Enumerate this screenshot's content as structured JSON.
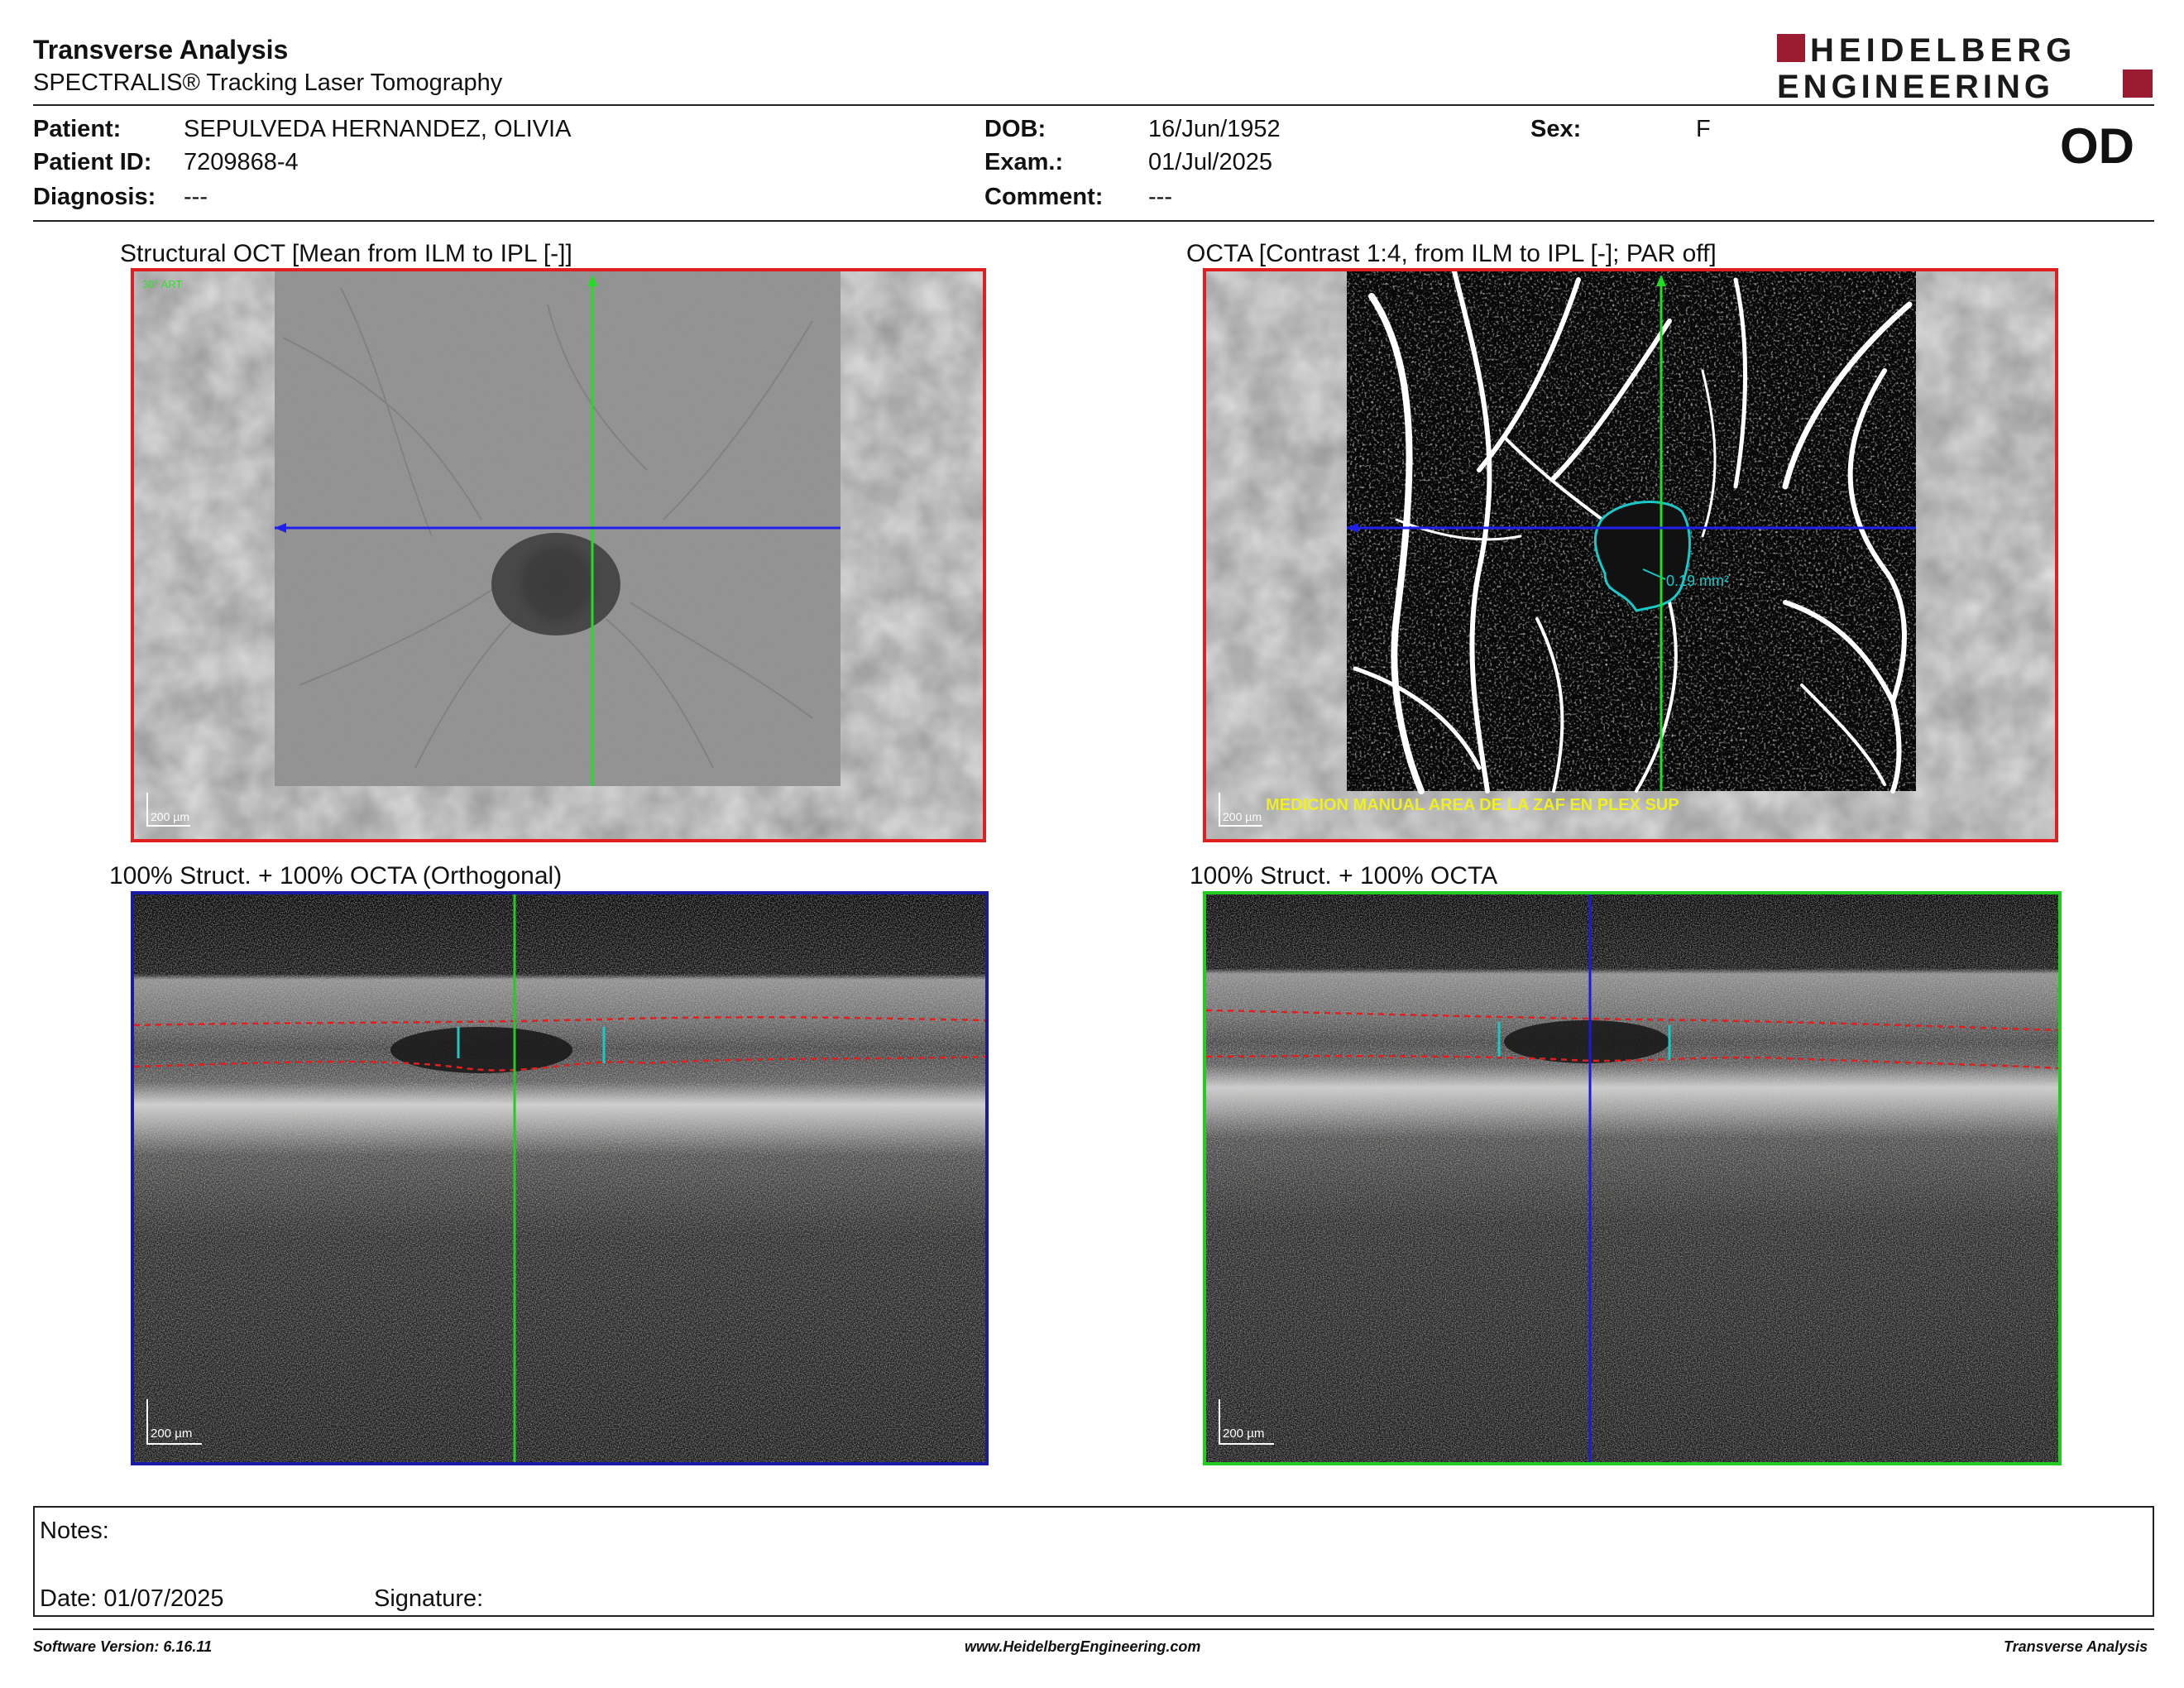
{
  "header": {
    "title": "Transverse Analysis",
    "subtitle": "SPECTRALIS® Tracking Laser Tomography",
    "brand_line1": "HEIDELBERG",
    "brand_line2": "ENGINEERING",
    "brand_color": "#9b1b30",
    "eye": "OD"
  },
  "patient": {
    "patient_label": "Patient:",
    "patient_value": "SEPULVEDA HERNANDEZ, OLIVIA",
    "id_label": "Patient ID:",
    "id_value": "7209868-4",
    "diagnosis_label": "Diagnosis:",
    "diagnosis_value": "---",
    "dob_label": "DOB:",
    "dob_value": "16/Jun/1952",
    "exam_label": "Exam.:",
    "exam_value": "01/Jul/2025",
    "comment_label": "Comment:",
    "comment_value": "---",
    "sex_label": "Sex:",
    "sex_value": "F"
  },
  "panels": {
    "structural": {
      "title": "Structural OCT [Mean from ILM to IPL [-]]",
      "scale": "200 µm",
      "corner": "30° ART",
      "border_color": "#e02020"
    },
    "octa": {
      "title": "OCTA [Contrast 1:4, from ILM to IPL [-]; PAR off]",
      "scale": "200 µm",
      "area": "0.19 mm²",
      "annotation": "MEDICION MANUAL AREA DE LA ZAF EN PLEX SUP",
      "border_color": "#e02020"
    },
    "orthogonal": {
      "title": "100% Struct. + 100% OCTA (Orthogonal)",
      "scale": "200 µm",
      "border_color": "#1a1aa8"
    },
    "bscan": {
      "title": "100% Struct. + 100% OCTA",
      "scale": "200 µm",
      "border_color": "#22cc22"
    }
  },
  "notes": {
    "notes_label": "Notes:",
    "date_label": "Date: 01/07/2025",
    "signature_label": "Signature:"
  },
  "footer": {
    "software": "Software Version: 6.16.11",
    "website": "www.HeidelbergEngineering.com",
    "report": "Transverse Analysis"
  }
}
